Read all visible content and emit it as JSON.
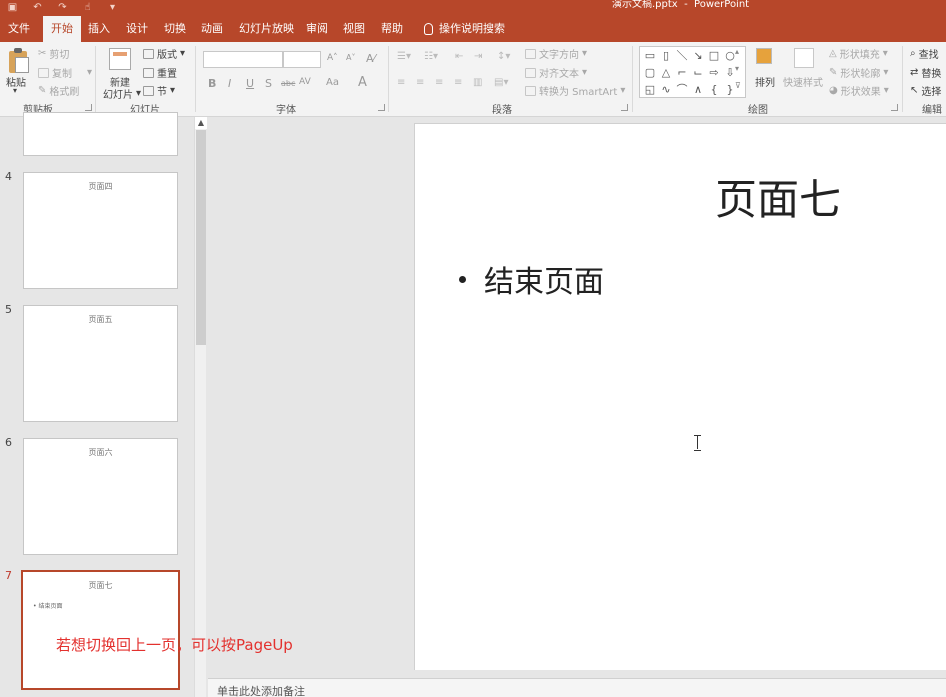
{
  "window": {
    "title": "演示文稿.pptx  -  PowerPoint",
    "qat": [
      "save",
      "undo",
      "redo",
      "touch",
      "customize"
    ]
  },
  "tabs": [
    {
      "label": "文件",
      "active": false
    },
    {
      "label": "开始",
      "active": true
    },
    {
      "label": "插入",
      "active": false
    },
    {
      "label": "设计",
      "active": false
    },
    {
      "label": "切换",
      "active": false
    },
    {
      "label": "动画",
      "active": false
    },
    {
      "label": "幻灯片放映",
      "active": false
    },
    {
      "label": "审阅",
      "active": false
    },
    {
      "label": "视图",
      "active": false
    },
    {
      "label": "帮助",
      "active": false
    }
  ],
  "tell_me": "操作说明搜索",
  "ribbon": {
    "clipboard": {
      "paste": "粘贴",
      "cut": "剪切",
      "copy": "复制",
      "format_painter": "格式刷",
      "group_label": "剪贴板"
    },
    "slides": {
      "new_slide": "新建",
      "new_slide2": "幻灯片",
      "layout": "版式",
      "reset": "重置",
      "section": "节",
      "group_label": "幻灯片"
    },
    "font": {
      "group_label": "字体",
      "bold": "B",
      "italic": "I",
      "underline": "U",
      "strike": "S",
      "abc": "abc",
      "av": "AV",
      "aa": "Aa",
      "a_big": "A"
    },
    "paragraph": {
      "group_label": "段落",
      "text_direction": "文字方向",
      "align_text": "对齐文本",
      "smartart": "转换为 SmartArt"
    },
    "drawing": {
      "group_label": "绘图",
      "arrange": "排列",
      "quick_styles": "快速样式",
      "shape_fill": "形状填充",
      "shape_outline": "形状轮廓",
      "shape_effects": "形状效果"
    },
    "editing": {
      "group_label": "编辑",
      "find": "查找",
      "replace": "替换",
      "select": "选择"
    }
  },
  "slides_panel": [
    {
      "number": "",
      "title": ""
    },
    {
      "number": "4",
      "title": "页面四"
    },
    {
      "number": "5",
      "title": "页面五"
    },
    {
      "number": "6",
      "title": "页面六"
    },
    {
      "number": "7",
      "title": "页面七",
      "bullet": "• 结束页面",
      "selected": true
    }
  ],
  "current_slide": {
    "title": "页面七",
    "bullet": "结束页面"
  },
  "notes_placeholder": "单击此处添加备注",
  "caption": "若想切换回上一页，可以按PageUp",
  "colors": {
    "accent": "#b7472a",
    "caption": "#e3312e"
  }
}
